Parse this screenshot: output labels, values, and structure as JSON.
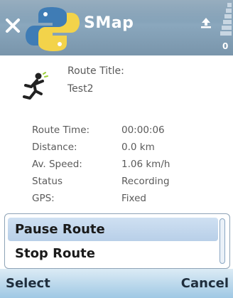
{
  "header": {
    "app_title": "SMap",
    "signal_badge": "0"
  },
  "route": {
    "title_label": "Route Title:",
    "title_value": "Test2",
    "stats": [
      {
        "label": "Route Time:",
        "value": "00:00:06"
      },
      {
        "label": "Distance:",
        "value": "0.0 km"
      },
      {
        "label": "Av. Speed:",
        "value": "1.06 km/h"
      },
      {
        "label": "Status",
        "value": "Recording"
      },
      {
        "label": "GPS:",
        "value": "Fixed"
      }
    ]
  },
  "menu": {
    "items": [
      {
        "label": "Pause Route",
        "selected": true
      },
      {
        "label": "Stop Route",
        "selected": false
      }
    ]
  },
  "softkeys": {
    "left": "Select",
    "right": "Cancel"
  }
}
